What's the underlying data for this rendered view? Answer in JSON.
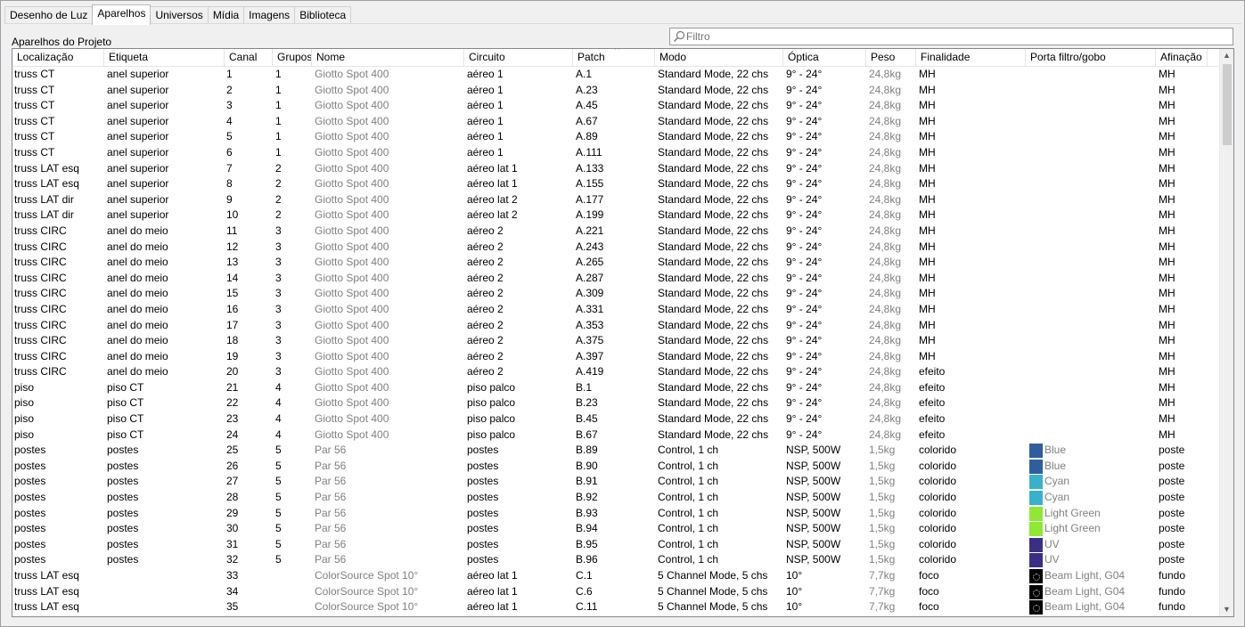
{
  "tabs": [
    "Desenho de Luz",
    "Aparelhos",
    "Universos",
    "Mídia",
    "Imagens",
    "Biblioteca"
  ],
  "active_tab": 1,
  "section_label": "Aparelhos do Projeto",
  "filter": {
    "placeholder": "Filtro",
    "value": ""
  },
  "columns": [
    "Localização",
    "Etiqueta",
    "Canal",
    "Grupos",
    "Nome",
    "Circuito",
    "Patch",
    "Modo",
    "Óptica",
    "Peso",
    "Finalidade",
    "Porta filtro/gobo",
    "Afinação"
  ],
  "sorted_column": "Patch",
  "colors": {
    "Blue": "#2e5e9e",
    "Cyan": "#3ab1cc",
    "Light Green": "#8fe832",
    "UV": "#3a2f86"
  },
  "rows": [
    [
      "truss CT",
      "anel superior",
      "1",
      "1",
      "Giotto Spot 400",
      "aéreo 1",
      "A.1",
      "Standard Mode, 22 chs",
      "9° - 24°",
      "24,8kg",
      "MH",
      "",
      "MH"
    ],
    [
      "truss CT",
      "anel superior",
      "2",
      "1",
      "Giotto Spot 400",
      "aéreo 1",
      "A.23",
      "Standard Mode, 22 chs",
      "9° - 24°",
      "24,8kg",
      "MH",
      "",
      "MH"
    ],
    [
      "truss CT",
      "anel superior",
      "3",
      "1",
      "Giotto Spot 400",
      "aéreo 1",
      "A.45",
      "Standard Mode, 22 chs",
      "9° - 24°",
      "24,8kg",
      "MH",
      "",
      "MH"
    ],
    [
      "truss CT",
      "anel superior",
      "4",
      "1",
      "Giotto Spot 400",
      "aéreo 1",
      "A.67",
      "Standard Mode, 22 chs",
      "9° - 24°",
      "24,8kg",
      "MH",
      "",
      "MH"
    ],
    [
      "truss CT",
      "anel superior",
      "5",
      "1",
      "Giotto Spot 400",
      "aéreo 1",
      "A.89",
      "Standard Mode, 22 chs",
      "9° - 24°",
      "24,8kg",
      "MH",
      "",
      "MH"
    ],
    [
      "truss CT",
      "anel superior",
      "6",
      "1",
      "Giotto Spot 400",
      "aéreo 1",
      "A.111",
      "Standard Mode, 22 chs",
      "9° - 24°",
      "24,8kg",
      "MH",
      "",
      "MH"
    ],
    [
      "truss LAT esq",
      "anel superior",
      "7",
      "2",
      "Giotto Spot 400",
      "aéreo lat 1",
      "A.133",
      "Standard Mode, 22 chs",
      "9° - 24°",
      "24,8kg",
      "MH",
      "",
      "MH"
    ],
    [
      "truss LAT esq",
      "anel superior",
      "8",
      "2",
      "Giotto Spot 400",
      "aéreo lat 1",
      "A.155",
      "Standard Mode, 22 chs",
      "9° - 24°",
      "24,8kg",
      "MH",
      "",
      "MH"
    ],
    [
      "truss LAT dir",
      "anel superior",
      "9",
      "2",
      "Giotto Spot 400",
      "aéreo lat 2",
      "A.177",
      "Standard Mode, 22 chs",
      "9° - 24°",
      "24,8kg",
      "MH",
      "",
      "MH"
    ],
    [
      "truss LAT dir",
      "anel superior",
      "10",
      "2",
      "Giotto Spot 400",
      "aéreo lat 2",
      "A.199",
      "Standard Mode, 22 chs",
      "9° - 24°",
      "24,8kg",
      "MH",
      "",
      "MH"
    ],
    [
      "truss CIRC",
      "anel do meio",
      "11",
      "3",
      "Giotto Spot 400",
      "aéreo 2",
      "A.221",
      "Standard Mode, 22 chs",
      "9° - 24°",
      "24,8kg",
      "MH",
      "",
      "MH"
    ],
    [
      "truss CIRC",
      "anel do meio",
      "12",
      "3",
      "Giotto Spot 400",
      "aéreo 2",
      "A.243",
      "Standard Mode, 22 chs",
      "9° - 24°",
      "24,8kg",
      "MH",
      "",
      "MH"
    ],
    [
      "truss CIRC",
      "anel do meio",
      "13",
      "3",
      "Giotto Spot 400",
      "aéreo 2",
      "A.265",
      "Standard Mode, 22 chs",
      "9° - 24°",
      "24,8kg",
      "MH",
      "",
      "MH"
    ],
    [
      "truss CIRC",
      "anel do meio",
      "14",
      "3",
      "Giotto Spot 400",
      "aéreo 2",
      "A.287",
      "Standard Mode, 22 chs",
      "9° - 24°",
      "24,8kg",
      "MH",
      "",
      "MH"
    ],
    [
      "truss CIRC",
      "anel do meio",
      "15",
      "3",
      "Giotto Spot 400",
      "aéreo 2",
      "A.309",
      "Standard Mode, 22 chs",
      "9° - 24°",
      "24,8kg",
      "MH",
      "",
      "MH"
    ],
    [
      "truss CIRC",
      "anel do meio",
      "16",
      "3",
      "Giotto Spot 400",
      "aéreo 2",
      "A.331",
      "Standard Mode, 22 chs",
      "9° - 24°",
      "24,8kg",
      "MH",
      "",
      "MH"
    ],
    [
      "truss CIRC",
      "anel do meio",
      "17",
      "3",
      "Giotto Spot 400",
      "aéreo 2",
      "A.353",
      "Standard Mode, 22 chs",
      "9° - 24°",
      "24,8kg",
      "MH",
      "",
      "MH"
    ],
    [
      "truss CIRC",
      "anel do meio",
      "18",
      "3",
      "Giotto Spot 400",
      "aéreo 2",
      "A.375",
      "Standard Mode, 22 chs",
      "9° - 24°",
      "24,8kg",
      "MH",
      "",
      "MH"
    ],
    [
      "truss CIRC",
      "anel do meio",
      "19",
      "3",
      "Giotto Spot 400",
      "aéreo 2",
      "A.397",
      "Standard Mode, 22 chs",
      "9° - 24°",
      "24,8kg",
      "MH",
      "",
      "MH"
    ],
    [
      "truss CIRC",
      "anel do meio",
      "20",
      "3",
      "Giotto Spot 400",
      "aéreo 2",
      "A.419",
      "Standard Mode, 22 chs",
      "9° - 24°",
      "24,8kg",
      "efeito",
      "",
      "MH"
    ],
    [
      "piso",
      "piso CT",
      "21",
      "4",
      "Giotto Spot 400",
      "piso palco",
      "B.1",
      "Standard Mode, 22 chs",
      "9° - 24°",
      "24,8kg",
      "efeito",
      "",
      "MH"
    ],
    [
      "piso",
      "piso CT",
      "22",
      "4",
      "Giotto Spot 400",
      "piso palco",
      "B.23",
      "Standard Mode, 22 chs",
      "9° - 24°",
      "24,8kg",
      "efeito",
      "",
      "MH"
    ],
    [
      "piso",
      "piso CT",
      "23",
      "4",
      "Giotto Spot 400",
      "piso palco",
      "B.45",
      "Standard Mode, 22 chs",
      "9° - 24°",
      "24,8kg",
      "efeito",
      "",
      "MH"
    ],
    [
      "piso",
      "piso CT",
      "24",
      "4",
      "Giotto Spot 400",
      "piso palco",
      "B.67",
      "Standard Mode, 22 chs",
      "9° - 24°",
      "24,8kg",
      "efeito",
      "",
      "MH"
    ],
    [
      "postes",
      "postes",
      "25",
      "5",
      "Par 56",
      "postes",
      "B.89",
      "Control, 1 ch",
      "NSP, 500W",
      "1,5kg",
      "colorido",
      "Blue",
      "poste"
    ],
    [
      "postes",
      "postes",
      "26",
      "5",
      "Par 56",
      "postes",
      "B.90",
      "Control, 1 ch",
      "NSP, 500W",
      "1,5kg",
      "colorido",
      "Blue",
      "poste"
    ],
    [
      "postes",
      "postes",
      "27",
      "5",
      "Par 56",
      "postes",
      "B.91",
      "Control, 1 ch",
      "NSP, 500W",
      "1,5kg",
      "colorido",
      "Cyan",
      "poste"
    ],
    [
      "postes",
      "postes",
      "28",
      "5",
      "Par 56",
      "postes",
      "B.92",
      "Control, 1 ch",
      "NSP, 500W",
      "1,5kg",
      "colorido",
      "Cyan",
      "poste"
    ],
    [
      "postes",
      "postes",
      "29",
      "5",
      "Par 56",
      "postes",
      "B.93",
      "Control, 1 ch",
      "NSP, 500W",
      "1,5kg",
      "colorido",
      "Light Green",
      "poste"
    ],
    [
      "postes",
      "postes",
      "30",
      "5",
      "Par 56",
      "postes",
      "B.94",
      "Control, 1 ch",
      "NSP, 500W",
      "1,5kg",
      "colorido",
      "Light Green",
      "poste"
    ],
    [
      "postes",
      "postes",
      "31",
      "5",
      "Par 56",
      "postes",
      "B.95",
      "Control, 1 ch",
      "NSP, 500W",
      "1,5kg",
      "colorido",
      "UV",
      "poste"
    ],
    [
      "postes",
      "postes",
      "32",
      "5",
      "Par 56",
      "postes",
      "B.96",
      "Control, 1 ch",
      "NSP, 500W",
      "1,5kg",
      "colorido",
      "UV",
      "poste"
    ],
    [
      "truss LAT esq",
      "",
      "33",
      "",
      "ColorSource Spot 10°",
      "aéreo lat 1",
      "C.1",
      "5 Channel Mode, 5 chs",
      "10°",
      "7,7kg",
      "foco",
      "Beam Light, G04",
      "fundo"
    ],
    [
      "truss LAT esq",
      "",
      "34",
      "",
      "ColorSource Spot 10°",
      "aéreo lat 1",
      "C.6",
      "5 Channel Mode, 5 chs",
      "10°",
      "7,7kg",
      "foco",
      "Beam Light, G04",
      "fundo"
    ],
    [
      "truss LAT esq",
      "",
      "35",
      "",
      "ColorSource Spot 10°",
      "aéreo lat 1",
      "C.11",
      "5 Channel Mode, 5 chs",
      "10°",
      "7,7kg",
      "foco",
      "Beam Light, G04",
      "fundo"
    ]
  ]
}
